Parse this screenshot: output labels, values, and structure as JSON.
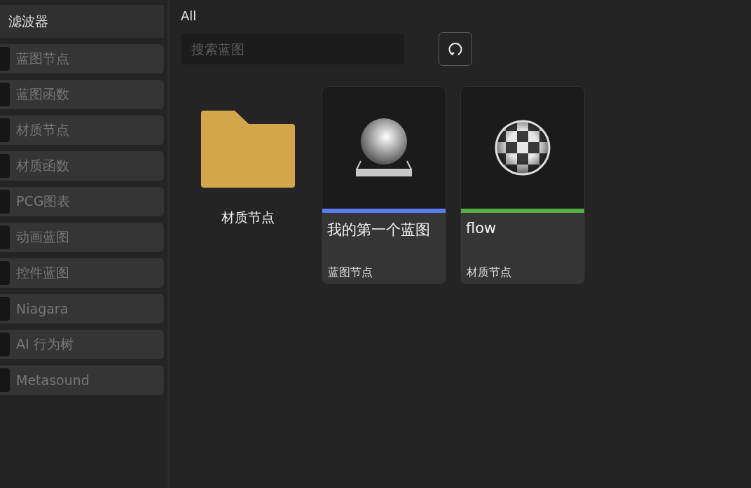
{
  "sidebar": {
    "title": "滤波器",
    "items": [
      {
        "label": "蓝图节点",
        "checked": false
      },
      {
        "label": "蓝图函数",
        "checked": false
      },
      {
        "label": "材质节点",
        "checked": false
      },
      {
        "label": "材质函数",
        "checked": false
      },
      {
        "label": "PCG图表",
        "checked": false
      },
      {
        "label": "动画蓝图",
        "checked": false
      },
      {
        "label": "控件蓝图",
        "checked": false
      },
      {
        "label": "Niagara",
        "checked": false
      },
      {
        "label": "AI 行为树",
        "checked": false
      },
      {
        "label": "Metasound",
        "checked": false
      }
    ]
  },
  "main": {
    "breadcrumb": "All",
    "search": {
      "placeholder": "搜索蓝图"
    },
    "assets": [
      {
        "kind": "folder",
        "name": "材质节点"
      },
      {
        "kind": "asset",
        "thumbnail": {
          "kind": "sphere"
        },
        "name": "我的第一个蓝图",
        "type": "蓝图节点",
        "color": "#5a7cf0"
      },
      {
        "kind": "asset",
        "thumbnail": {
          "kind": "checker"
        },
        "name": "flow",
        "type": "材质节点",
        "color": "#55b043"
      }
    ]
  }
}
